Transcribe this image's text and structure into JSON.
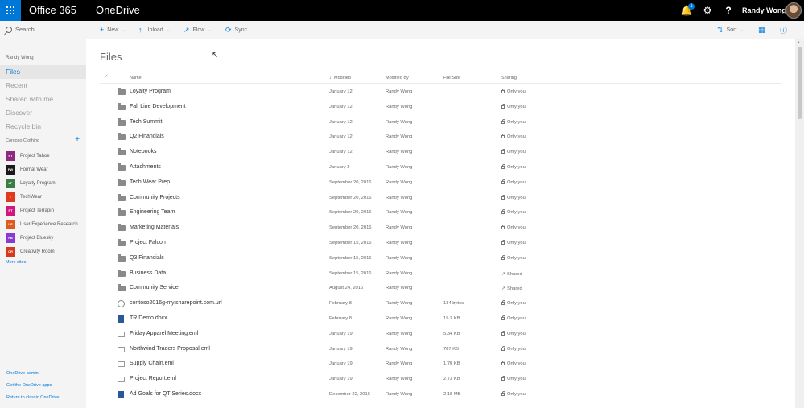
{
  "topbar": {
    "brand": "Office 365",
    "app": "OneDrive",
    "notifications_count": "1",
    "help_label": "?",
    "user_name": "Randy Wong",
    "icons": [
      "waffle-icon",
      "bell-icon",
      "gear-icon",
      "help-icon"
    ]
  },
  "sidebar": {
    "search_placeholder": "Search",
    "user": "Randy Wong",
    "nav": [
      "Files",
      "Recent",
      "Shared with me",
      "Discover",
      "Recycle bin"
    ],
    "group_title": "Contoso Clothing",
    "group_add": "+",
    "sites": [
      {
        "initials": "PT",
        "label": "Project Tahoe",
        "color": "#8b2a7f"
      },
      {
        "initials": "FW",
        "label": "Formal Wear",
        "color": "#1a1a1a"
      },
      {
        "initials": "LP",
        "label": "Loyalty Program",
        "color": "#3a7d44"
      },
      {
        "initials": "T",
        "label": "TechWear",
        "color": "#e03a1e"
      },
      {
        "initials": "PT",
        "label": "Project Terrapin",
        "color": "#d4157b"
      },
      {
        "initials": "UE",
        "label": "User Experience Research",
        "color": "#e05a1e"
      },
      {
        "initials": "PB",
        "label": "Project Bluesky",
        "color": "#8a3ad4"
      },
      {
        "initials": "CR",
        "label": "Creativity Room",
        "color": "#d43a1e"
      }
    ],
    "more_sites": "More sites",
    "footer": [
      "OneDrive admin",
      "Get the OneDrive apps",
      "Return to classic OneDrive"
    ]
  },
  "commandbar": {
    "new": "New",
    "upload": "Upload",
    "flow": "Flow",
    "sync": "Sync",
    "sort": "Sort"
  },
  "main": {
    "title": "Files",
    "columns": {
      "name": "Name",
      "modified": "Modified",
      "modified_by": "Modified By",
      "file_size": "File Size",
      "sharing": "Sharing"
    },
    "rows": [
      {
        "type": "folder",
        "name": "Loyalty Program",
        "modified": "January 12",
        "by": "Randy Wong",
        "size": "",
        "sharing": "Only you",
        "shared": false
      },
      {
        "type": "folder",
        "name": "Fall Line Development",
        "modified": "January 12",
        "by": "Randy Wong",
        "size": "",
        "sharing": "Only you",
        "shared": false
      },
      {
        "type": "folder",
        "name": "Tech Summit",
        "modified": "January 12",
        "by": "Randy Wong",
        "size": "",
        "sharing": "Only you",
        "shared": false
      },
      {
        "type": "folder",
        "name": "Q2 Financials",
        "modified": "January 12",
        "by": "Randy Wong",
        "size": "",
        "sharing": "Only you",
        "shared": false
      },
      {
        "type": "folder",
        "name": "Notebooks",
        "modified": "January 12",
        "by": "Randy Wong",
        "size": "",
        "sharing": "Only you",
        "shared": false
      },
      {
        "type": "folder",
        "name": "Attachments",
        "modified": "January 3",
        "by": "Randy Wong",
        "size": "",
        "sharing": "Only you",
        "shared": false
      },
      {
        "type": "folder",
        "name": "Tech Wear Prep",
        "modified": "September 20, 2016",
        "by": "Randy Wong",
        "size": "",
        "sharing": "Only you",
        "shared": false
      },
      {
        "type": "folder",
        "name": "Community Projects",
        "modified": "September 20, 2016",
        "by": "Randy Wong",
        "size": "",
        "sharing": "Only you",
        "shared": false
      },
      {
        "type": "folder",
        "name": "Engineering Team",
        "modified": "September 20, 2016",
        "by": "Randy Wong",
        "size": "",
        "sharing": "Only you",
        "shared": false
      },
      {
        "type": "folder",
        "name": "Marketing Materials",
        "modified": "September 20, 2016",
        "by": "Randy Wong",
        "size": "",
        "sharing": "Only you",
        "shared": false
      },
      {
        "type": "folder",
        "name": "Project Falcon",
        "modified": "September 15, 2016",
        "by": "Randy Wong",
        "size": "",
        "sharing": "Only you",
        "shared": false
      },
      {
        "type": "folder",
        "name": "Q3 Financials",
        "modified": "September 15, 2016",
        "by": "Randy Wong",
        "size": "",
        "sharing": "Only you",
        "shared": false
      },
      {
        "type": "folder",
        "name": "Business Data",
        "modified": "September 15, 2016",
        "by": "Randy Wong",
        "size": "",
        "sharing": "Shared",
        "shared": true
      },
      {
        "type": "folder",
        "name": "Community Service",
        "modified": "August 24, 2016",
        "by": "Randy Wong",
        "size": "",
        "sharing": "Shared",
        "shared": true
      },
      {
        "type": "url",
        "name": "contoso2016g-my.sharepoint.com.url",
        "modified": "February 8",
        "by": "Randy Wong",
        "size": "134 bytes",
        "sharing": "Only you",
        "shared": false
      },
      {
        "type": "doc",
        "name": "TR Demo.docx",
        "modified": "February 8",
        "by": "Randy Wong",
        "size": "15.3 KB",
        "sharing": "Only you",
        "shared": false
      },
      {
        "type": "eml",
        "name": "Friday Apparel Meeting.eml",
        "modified": "January 19",
        "by": "Randy Wong",
        "size": "5.34 KB",
        "sharing": "Only you",
        "shared": false
      },
      {
        "type": "eml",
        "name": "Northwind Traders Proposal.eml",
        "modified": "January 19",
        "by": "Randy Wong",
        "size": "787 KB",
        "sharing": "Only you",
        "shared": false
      },
      {
        "type": "eml",
        "name": "Supply Chain.eml",
        "modified": "January 19",
        "by": "Randy Wong",
        "size": "1.70 KB",
        "sharing": "Only you",
        "shared": false
      },
      {
        "type": "eml",
        "name": "Project Report.eml",
        "modified": "January 19",
        "by": "Randy Wong",
        "size": "2.73 KB",
        "sharing": "Only you",
        "shared": false
      },
      {
        "type": "doc",
        "name": "Ad Goals for QT Series.docx",
        "modified": "December 22, 2016",
        "by": "Randy Wong",
        "size": "2.18 MB",
        "sharing": "Only you",
        "shared": false
      }
    ]
  },
  "colors": {
    "accent": "#0078d7",
    "topbar": "#000000",
    "sidebar": "#f4f4f4"
  }
}
